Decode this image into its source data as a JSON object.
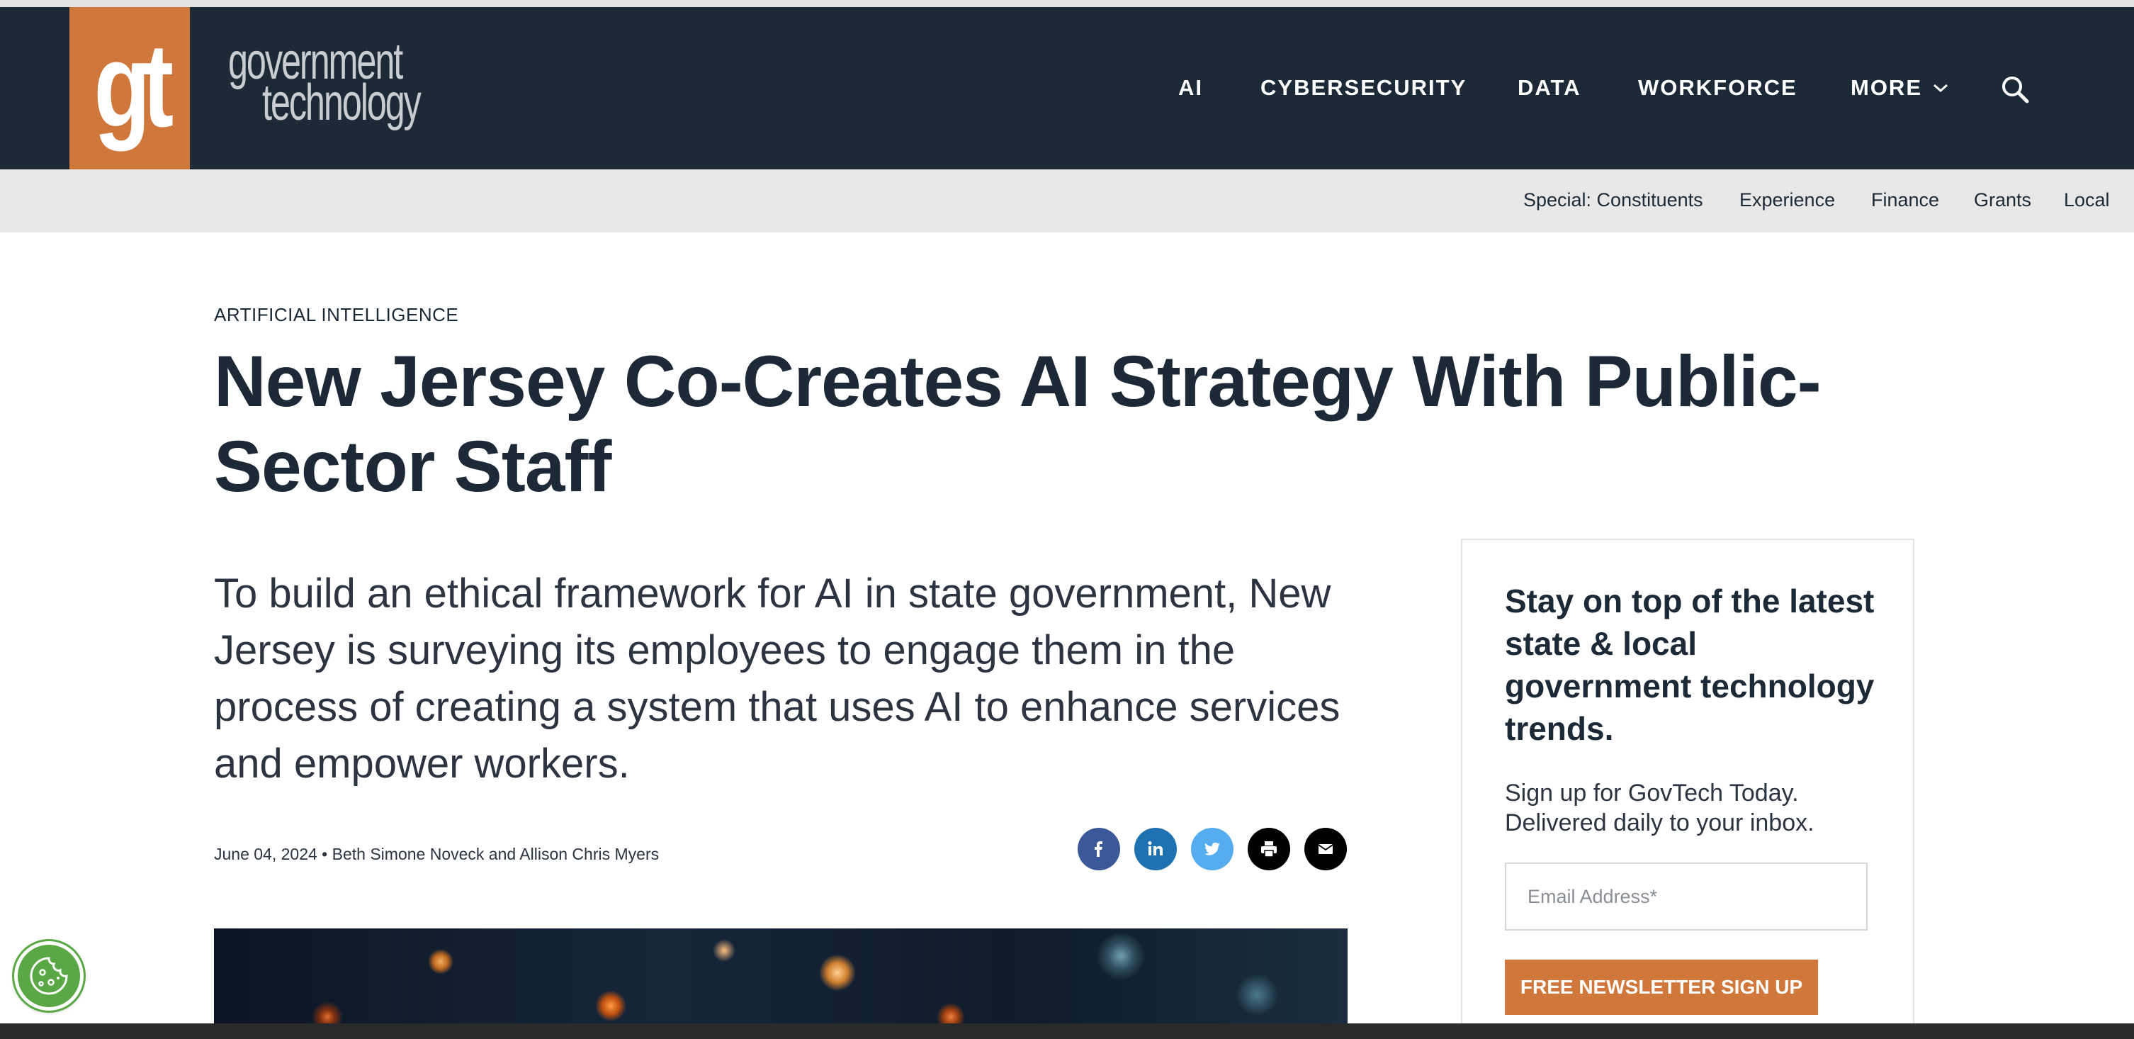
{
  "header": {
    "logo_mark": "gt",
    "wordmark_line1": "government",
    "wordmark_line2": "technology",
    "nav": [
      {
        "label": "AI"
      },
      {
        "label": "CYBERSECURITY"
      },
      {
        "label": "DATA"
      },
      {
        "label": "WORKFORCE"
      },
      {
        "label": "MORE"
      }
    ],
    "search_icon": "search-icon"
  },
  "subnav": {
    "items": [
      {
        "label": "Special: Constituents"
      },
      {
        "label": "Experience"
      },
      {
        "label": "Finance"
      },
      {
        "label": "Grants"
      },
      {
        "label": "Local"
      }
    ]
  },
  "article": {
    "kicker": "ARTIFICIAL INTELLIGENCE",
    "headline": "New Jersey Co-Creates AI Strategy With Public-Sector Staff",
    "dek": "To build an ethical framework for AI in state government, New Jersey is surveying its employees to engage them in the process of creating a system that uses AI to enhance services and empower workers.",
    "byline": "June 04, 2024 • Beth Simone Noveck and Allison Chris Myers",
    "share": [
      "facebook-icon",
      "linkedin-icon",
      "twitter-icon",
      "print-icon",
      "email-icon"
    ]
  },
  "newsletter": {
    "title": "Stay on top of the latest state & local government technology trends.",
    "text": "Sign up for GovTech Today. Delivered daily to your inbox.",
    "email_placeholder": "Email Address*",
    "button": "FREE NEWSLETTER SIGN UP"
  },
  "colors": {
    "header_bg": "#1c2a37",
    "brand_orange": "#d0773c",
    "subnav_bg": "#e8e8e8"
  }
}
